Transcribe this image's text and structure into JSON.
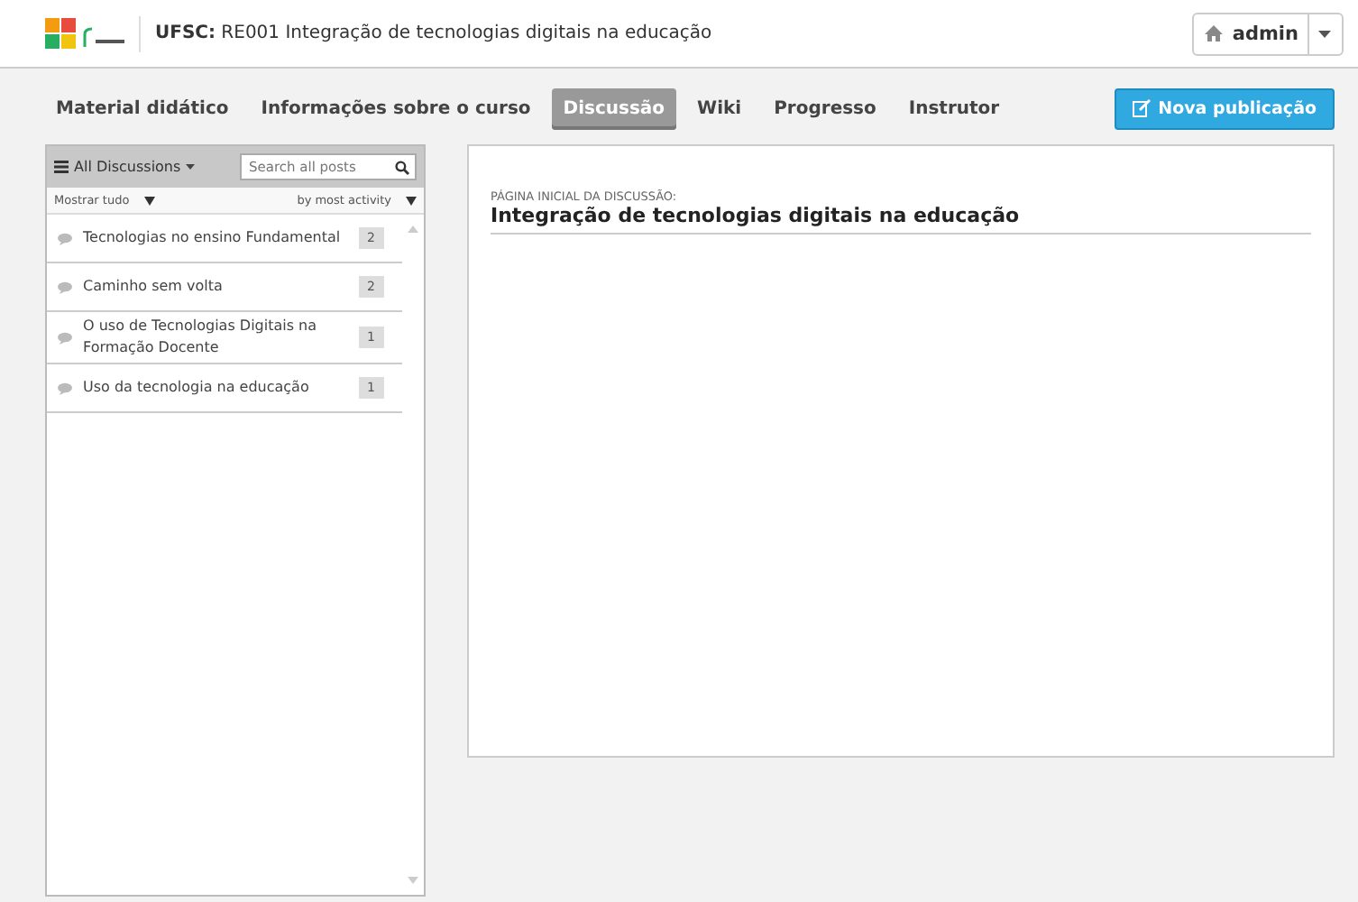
{
  "header": {
    "org": "UFSC:",
    "course_title": "RE001 Integração de tecnologias digitais na educação",
    "user": "admin"
  },
  "tabs": [
    {
      "label": "Material didático",
      "selected": false
    },
    {
      "label": "Informações sobre o curso",
      "selected": false
    },
    {
      "label": "Discussão",
      "selected": true
    },
    {
      "label": "Wiki",
      "selected": false
    },
    {
      "label": "Progresso",
      "selected": false
    },
    {
      "label": "Instrutor",
      "selected": false
    }
  ],
  "new_post_button": "Nova publicação",
  "sidebar": {
    "filter": "All Discussions",
    "search": {
      "placeholder": "Search all posts"
    },
    "show": "Mostrar tudo",
    "sort": "by most activity",
    "threads": [
      {
        "title": "Tecnologias no ensino Fundamental",
        "count": "2"
      },
      {
        "title": "Caminho sem volta",
        "count": "2"
      },
      {
        "title": "O uso de Tecnologias Digitais na Formação Docente",
        "count": "1"
      },
      {
        "title": "Uso da tecnologia na educação",
        "count": "1"
      }
    ]
  },
  "main": {
    "label": "PÁGINA INICIAL DA DISCUSSÃO:",
    "title": "Integração de tecnologias digitais na educação"
  }
}
